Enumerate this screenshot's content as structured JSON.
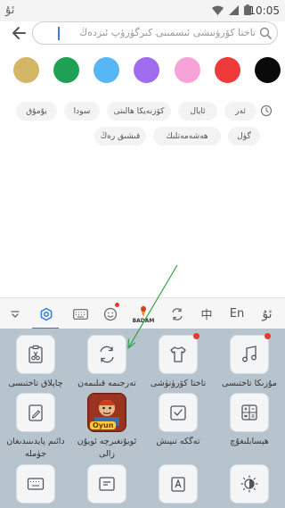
{
  "status_bar": {
    "left_glyph": "ئۇ",
    "time": "10:05"
  },
  "search": {
    "placeholder": "تاختا كۆرۈنىشى ئىسمىنى كىرگۈزۈپ ئىزدەڭ"
  },
  "colors": [
    "#d4b765",
    "#1ea154",
    "#57b6f5",
    "#a06cf0",
    "#f7a2d8",
    "#f0393b",
    "#0a0a0a"
  ],
  "history": {
    "row1": [
      "ئەر",
      "ئايال",
      "كۆزنەيكا ھالىتى",
      "سودا",
      "يۇمۇق"
    ],
    "row2": [
      "گۈل",
      "ھەشەمەتلىك",
      "قىشىق رەڭ"
    ]
  },
  "toolbar": {
    "items": [
      "collapse-icon",
      "settings-icon",
      "keyboard-icon",
      "emoji-icon",
      "badam-icon",
      "translate-icon",
      "中",
      "En",
      "ئۇ"
    ],
    "badam_label": "BADAM",
    "zh": "中",
    "en": "En",
    "ug": "ئۇ"
  },
  "panel": {
    "tiles": [
      {
        "label": "مۇزىكا تاختىسى",
        "icon": "music-note-icon",
        "new": true
      },
      {
        "label": "تاختا كۆرۈنۈشى",
        "icon": "tshirt-icon",
        "new": true
      },
      {
        "label": "تەرجىمە قىلىمەن",
        "icon": "translate-icon",
        "new": false
      },
      {
        "label": "چاپلاق تاختىسى",
        "icon": "clipboard-icon",
        "new": false
      },
      {
        "label": "ھېسابلىغۇچ",
        "icon": "calculator-icon",
        "new": false
      },
      {
        "label": "تەگكە تىپىش",
        "icon": "checkbox-icon",
        "new": false
      },
      {
        "label": "ئويۇنغىرچە ئويۇن زالى",
        "icon": "game-icon",
        "new": false,
        "badge": "Oyun"
      },
      {
        "label": "دائىم پايدىنىدىغان جۈملە",
        "icon": "note-edit-icon",
        "new": false
      }
    ]
  }
}
